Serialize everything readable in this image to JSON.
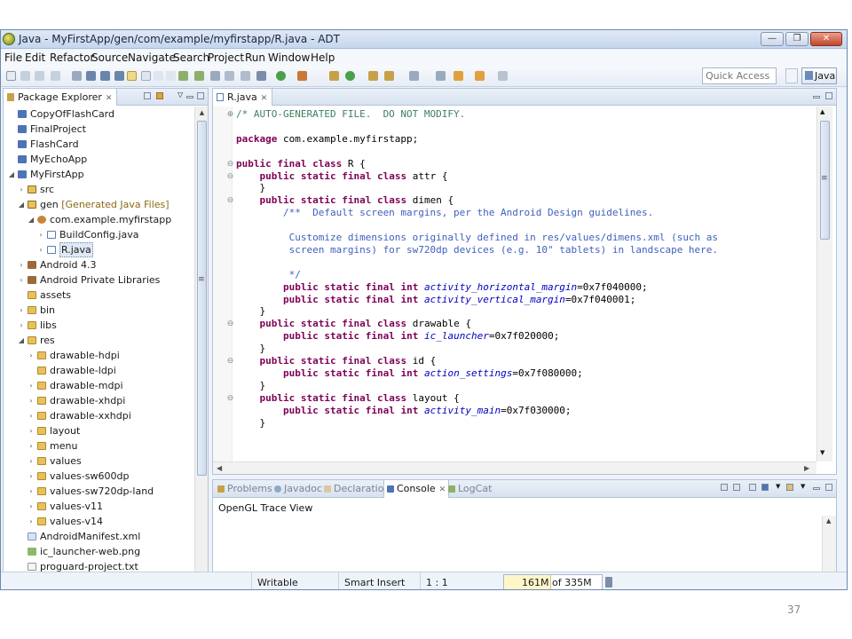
{
  "window": {
    "title": "Java - MyFirstApp/gen/com/example/myfirstapp/R.java - ADT",
    "minimize": "—",
    "maximize": "❐",
    "close": "✕"
  },
  "menu": [
    "File",
    "Edit",
    "Refactor",
    "Source",
    "Navigate",
    "Search",
    "Project",
    "Run",
    "Window",
    "Help"
  ],
  "toolbar": {
    "quick_access_placeholder": "Quick Access",
    "perspective_label": "Java"
  },
  "package_explorer": {
    "tab_label": "Package Explorer",
    "close": "✕",
    "items": [
      {
        "label": "CopyOfFlashCard",
        "decoration": "",
        "icon": "project-icon"
      },
      {
        "label": "FinalProject",
        "decoration": "",
        "icon": "project-icon"
      },
      {
        "label": "FlashCard",
        "decoration": "",
        "icon": "project-icon"
      },
      {
        "label": "MyEchoApp",
        "decoration": "",
        "icon": "project-icon"
      },
      {
        "label": "MyFirstApp",
        "decoration": "",
        "icon": "project-icon"
      },
      {
        "label": "src",
        "decoration": "",
        "icon": "source-folder-icon"
      },
      {
        "label": "gen",
        "decoration": "[Generated Java Files]",
        "icon": "source-folder-icon"
      },
      {
        "label": "com.example.myfirstapp",
        "decoration": "",
        "icon": "package-icon"
      },
      {
        "label": "BuildConfig.java",
        "decoration": "",
        "icon": "java-file-icon"
      },
      {
        "label": "R.java",
        "decoration": "",
        "icon": "java-file-icon"
      },
      {
        "label": "Android 4.3",
        "decoration": "",
        "icon": "library-icon"
      },
      {
        "label": "Android Private Libraries",
        "decoration": "",
        "icon": "library-icon"
      },
      {
        "label": "assets",
        "decoration": "",
        "icon": "folder-icon"
      },
      {
        "label": "bin",
        "decoration": "",
        "icon": "folder-icon"
      },
      {
        "label": "libs",
        "decoration": "",
        "icon": "folder-icon"
      },
      {
        "label": "res",
        "decoration": "",
        "icon": "folder-icon"
      },
      {
        "label": "drawable-hdpi",
        "decoration": "",
        "icon": "folder-icon"
      },
      {
        "label": "drawable-ldpi",
        "decoration": "",
        "icon": "folder-icon"
      },
      {
        "label": "drawable-mdpi",
        "decoration": "",
        "icon": "folder-icon"
      },
      {
        "label": "drawable-xhdpi",
        "decoration": "",
        "icon": "folder-icon"
      },
      {
        "label": "drawable-xxhdpi",
        "decoration": "",
        "icon": "folder-icon"
      },
      {
        "label": "layout",
        "decoration": "",
        "icon": "folder-icon"
      },
      {
        "label": "menu",
        "decoration": "",
        "icon": "folder-icon"
      },
      {
        "label": "values",
        "decoration": "",
        "icon": "folder-icon"
      },
      {
        "label": "values-sw600dp",
        "decoration": "",
        "icon": "folder-icon"
      },
      {
        "label": "values-sw720dp-land",
        "decoration": "",
        "icon": "folder-icon"
      },
      {
        "label": "values-v11",
        "decoration": "",
        "icon": "folder-icon"
      },
      {
        "label": "values-v14",
        "decoration": "",
        "icon": "folder-icon"
      },
      {
        "label": "AndroidManifest.xml",
        "decoration": "",
        "icon": "xml-file-icon"
      },
      {
        "label": "ic_launcher-web.png",
        "decoration": "",
        "icon": "image-file-icon"
      },
      {
        "label": "proguard-project.txt",
        "decoration": "",
        "icon": "text-file-icon"
      }
    ]
  },
  "editor": {
    "tab_label": "R.java",
    "close": "✕",
    "lines": [
      "/* AUTO-GENERATED FILE.  DO NOT MODIFY.",
      "",
      "package com.example.myfirstapp;",
      "",
      "public final class R {",
      "    public static final class attr {",
      "    }",
      "    public static final class dimen {",
      "        /**  Default screen margins, per the Android Design guidelines.",
      "",
      "         Customize dimensions originally defined in res/values/dimens.xml (such as",
      "         screen margins) for sw720dp devices (e.g. 10\" tablets) in landscape here.",
      "",
      "         */",
      "        public static final int activity_horizontal_margin=0x7f040000;",
      "        public static final int activity_vertical_margin=0x7f040001;",
      "    }",
      "    public static final class drawable {",
      "        public static final int ic_launcher=0x7f020000;",
      "    }",
      "    public static final class id {",
      "        public static final int action_settings=0x7f080000;",
      "    }",
      "    public static final class layout {",
      "        public static final int activity_main=0x7f030000;",
      "    }"
    ]
  },
  "bottom_panel": {
    "tabs": [
      "Problems",
      "Javadoc",
      "Declaration",
      "Console",
      "LogCat"
    ],
    "active_tab": "Console",
    "close": "✕",
    "console_title": "OpenGL Trace View"
  },
  "status": {
    "writable": "Writable",
    "insert_mode": "Smart Insert",
    "position": "1 : 1",
    "heap": "161M of 335M",
    "heap_used_fraction": 0.48
  },
  "slide_number": "37",
  "colors": {
    "keyword": "#7f0055",
    "comment": "#3f5fbf",
    "field": "#0000c0"
  }
}
